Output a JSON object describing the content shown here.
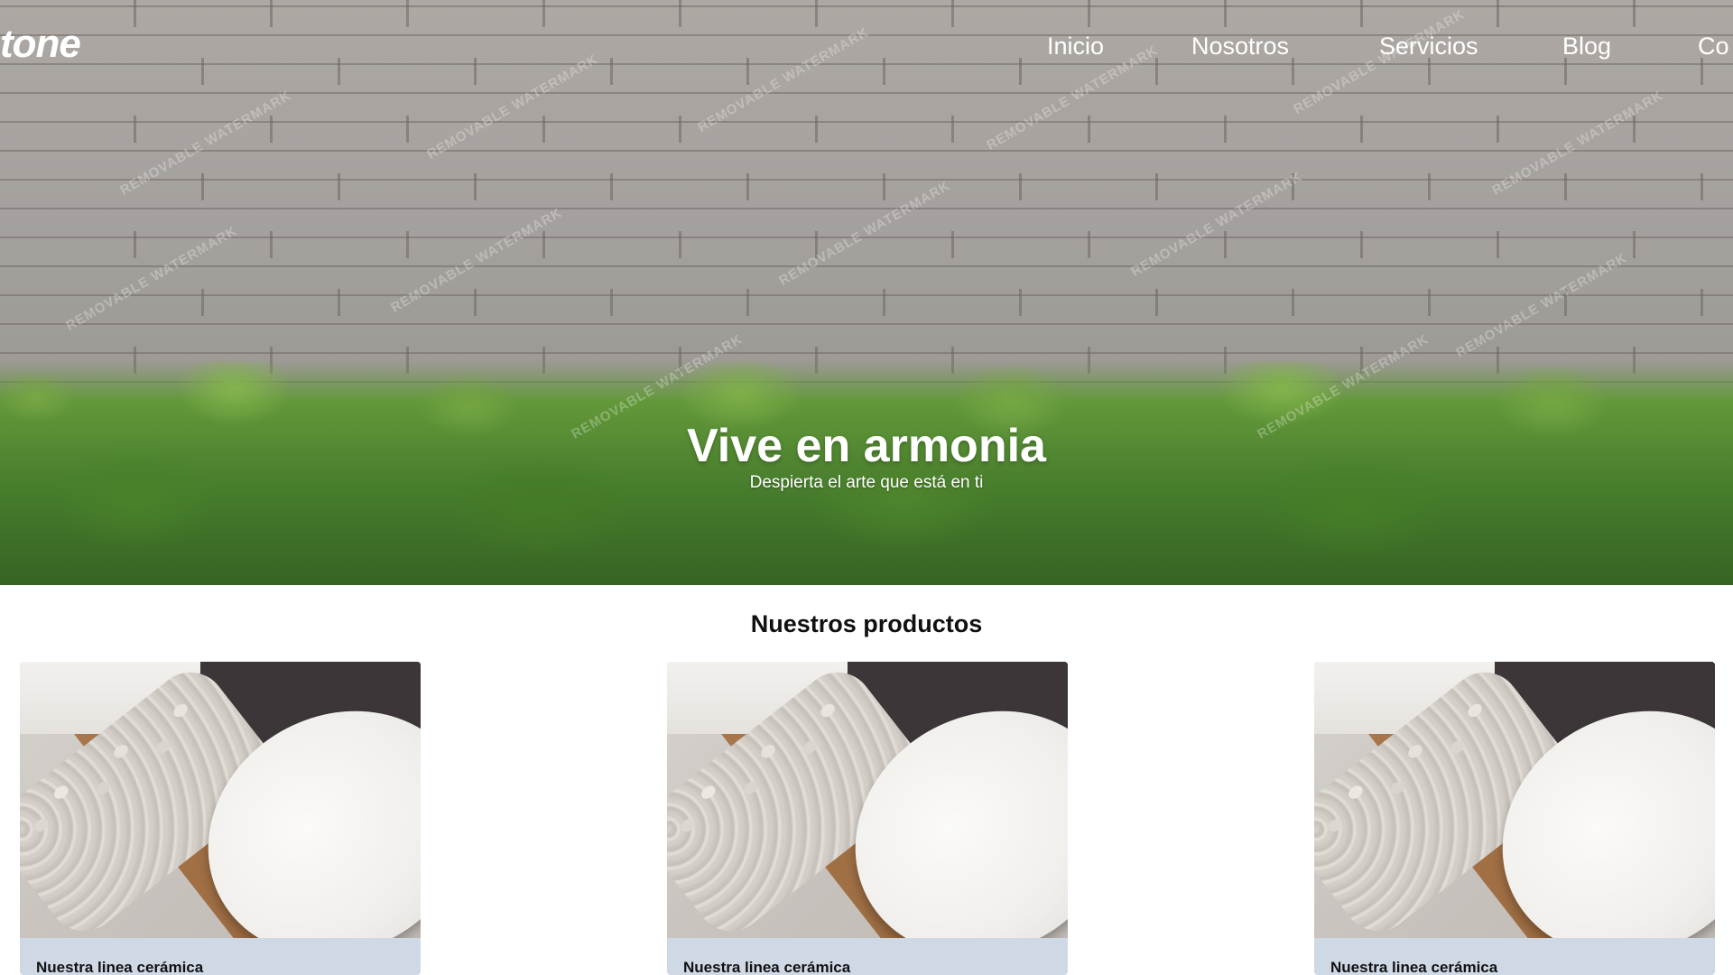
{
  "brand": {
    "logo_text": "tone"
  },
  "nav": {
    "items": [
      {
        "label": "Inicio"
      },
      {
        "label": "Nosotros"
      },
      {
        "label": "Servicios"
      },
      {
        "label": "Blog"
      },
      {
        "label": "Co"
      }
    ]
  },
  "hero": {
    "title": "Vive en armonia",
    "subtitle": "Despierta el arte que está en ti",
    "watermark": "REMOVABLE WATERMARK"
  },
  "products": {
    "title": "Nuestros productos",
    "cards": [
      {
        "label": "Nuestra linea cerámica"
      },
      {
        "label": "Nuestra linea cerámica"
      },
      {
        "label": "Nuestra linea cerámica"
      }
    ]
  },
  "colors": {
    "card_footer": "#cfd9e6",
    "hero_text": "#ffffff"
  }
}
